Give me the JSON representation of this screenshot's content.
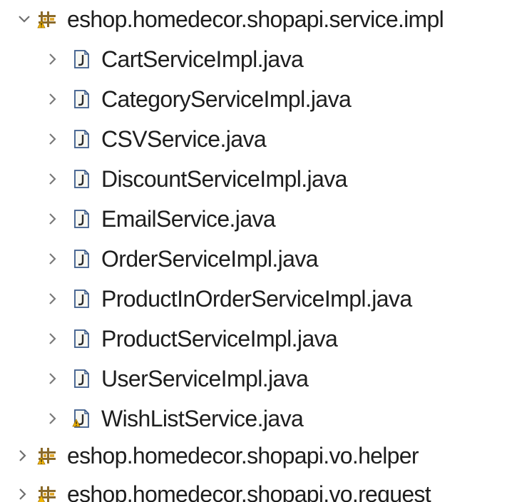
{
  "tree": {
    "packages": [
      {
        "name": "eshop.homedecor.shopapi.service.impl",
        "expanded": true,
        "files": [
          {
            "name": "CartServiceImpl.java",
            "decorated": false
          },
          {
            "name": "CategoryServiceImpl.java",
            "decorated": false
          },
          {
            "name": "CSVService.java",
            "decorated": false
          },
          {
            "name": "DiscountServiceImpl.java",
            "decorated": false
          },
          {
            "name": "EmailService.java",
            "decorated": false
          },
          {
            "name": "OrderServiceImpl.java",
            "decorated": false
          },
          {
            "name": "ProductInOrderServiceImpl.java",
            "decorated": false
          },
          {
            "name": "ProductServiceImpl.java",
            "decorated": false
          },
          {
            "name": "UserServiceImpl.java",
            "decorated": false
          },
          {
            "name": "WishListService.java",
            "decorated": true
          }
        ]
      },
      {
        "name": "eshop.homedecor.shopapi.vo.helper",
        "expanded": false
      },
      {
        "name": "eshop.homedecor.shopapi.vo.request",
        "expanded": false
      }
    ]
  },
  "icons": {
    "expanded": "chevron-down-icon",
    "collapsed": "chevron-right-icon",
    "package": "package-icon",
    "java_file": "java-file-icon",
    "warning_decorator": "warning-decorator-icon"
  },
  "colors": {
    "text": "#1e1e1e",
    "chevron": "#7a7a7a",
    "package_brown": "#8a6a2a",
    "package_gold": "#e0a82e",
    "file_border": "#3a5a8a",
    "file_fill": "#f5f5f0",
    "warning": "#f0b400"
  }
}
